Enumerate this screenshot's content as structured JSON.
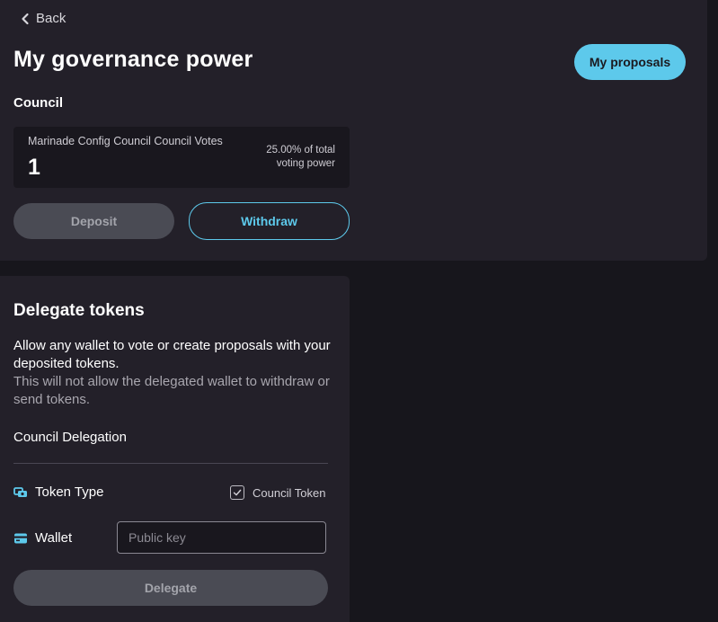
{
  "nav": {
    "back_label": "Back"
  },
  "header": {
    "title": "My governance power",
    "proposals_button": "My proposals"
  },
  "council": {
    "section_label": "Council",
    "card_label": "Marinade Config Council Council Votes",
    "votes": "1",
    "percent_line1": "25.00% of total",
    "percent_line2": "voting power",
    "deposit_button": "Deposit",
    "withdraw_button": "Withdraw"
  },
  "delegate": {
    "title": "Delegate tokens",
    "description": "Allow any wallet to vote or create proposals with your deposited tokens.",
    "note": "This will not allow the delegated wallet to withdraw or send tokens.",
    "section_label": "Council Delegation",
    "token_type_label": "Token Type",
    "token_option": "Council Token",
    "wallet_label": "Wallet",
    "wallet_placeholder": "Public key",
    "wallet_value": "",
    "delegate_button": "Delegate"
  },
  "colors": {
    "accent": "#5dc9eb",
    "background": "#17161c",
    "panel": "#232029",
    "disabled_button": "#4a4b54"
  },
  "icons": {
    "back": "chevron-left-icon",
    "token_type": "token-coins-icon",
    "wallet": "credit-card-icon",
    "checkbox": "check-icon"
  }
}
